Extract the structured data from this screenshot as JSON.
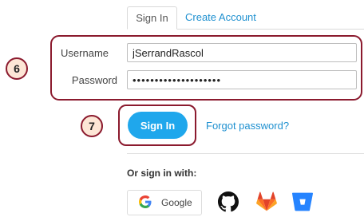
{
  "tabs": [
    {
      "label": "Sign In",
      "active": true
    },
    {
      "label": "Create Account",
      "active": false
    }
  ],
  "form": {
    "username_label": "Username",
    "username_value": "jSerrandRascol",
    "password_label": "Password",
    "password_value": "••••••••••••••••••••"
  },
  "annotations": {
    "fields_step": "6",
    "signin_step": "7"
  },
  "actions": {
    "signin_label": "Sign In",
    "forgot_label": "Forgot password?"
  },
  "social": {
    "heading": "Or sign in with:",
    "google_label": "Google",
    "providers": [
      "google-icon",
      "github-icon",
      "gitlab-icon",
      "bitbucket-icon"
    ]
  },
  "colors": {
    "accent": "#1fa7ec",
    "link": "#1e90d0",
    "annotation_border": "#8b1a2e",
    "annotation_fill": "#fde6d6"
  }
}
